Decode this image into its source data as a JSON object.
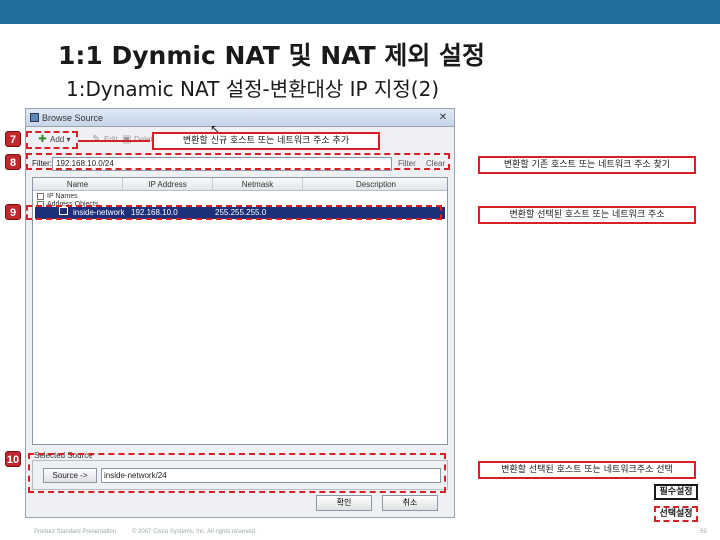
{
  "slide": {
    "title": "1:1 Dynmic NAT 및 NAT 제외 설정",
    "subtitle": "1:Dynamic NAT 설정-변환대상 IP 지정(2)"
  },
  "dialog": {
    "title": "Browse Source",
    "close": "✕",
    "toolbar": {
      "add": "Add",
      "edit": "Edit",
      "delete": "Delete"
    },
    "filter": {
      "label": "Filter:",
      "value": "192.168.10.0/24",
      "filter_btn": "Filter",
      "clear_btn": "Clear"
    },
    "columns": [
      "Name",
      "IP Address",
      "Netmask",
      "Description"
    ],
    "tree": [
      "IP Names",
      "Address Objects"
    ],
    "selected_row": {
      "name": "inside-network",
      "ip": "192.168.10.0",
      "netmask": "255.255.255.0"
    },
    "translate_label": "Selected Source",
    "source_button": "Source ->",
    "source_value": "inside-network/24",
    "ok": "확인",
    "cancel": "취소"
  },
  "annotations": {
    "badges": [
      "7",
      "8",
      "9",
      "10"
    ],
    "callout_7": "변환할 신규 호스트 또는 네트워크 주소 추가",
    "callout_8": "변환할 기존 호스트 또는 네트워크 주소 찾기",
    "callout_9": "변환할 선택된 호스트 또는 네트워크 주소",
    "callout_10": "변환할 선택된 호스트 또는 네트워크주소 선택",
    "legend_required": "필수설정",
    "legend_optional": "선택설정"
  },
  "footer": {
    "left": "Product Standard Presentation",
    "center": "© 2007 Cisco Systems, Inc. All rights reserved.",
    "page": "59"
  },
  "colors": {
    "accent_red": "#d91f26",
    "topbar": "#1f6e9c",
    "selection": "#1c2f7a"
  }
}
